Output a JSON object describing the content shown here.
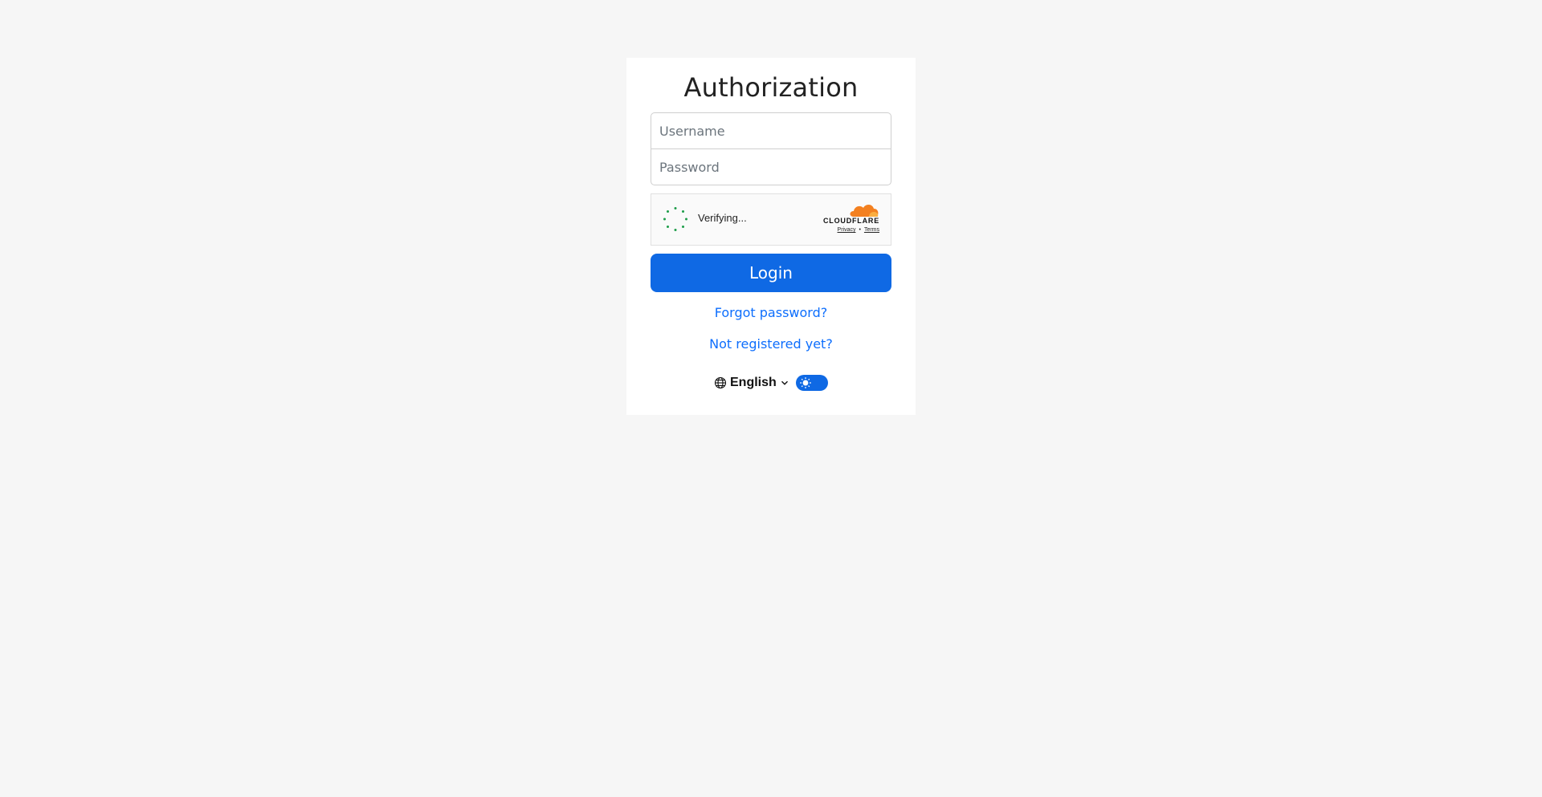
{
  "form": {
    "title": "Authorization",
    "username_placeholder": "Username",
    "password_placeholder": "Password",
    "login_label": "Login",
    "forgot_label": "Forgot password?",
    "register_label": "Not registered yet?"
  },
  "captcha": {
    "status": "Verifying...",
    "brand": "CLOUDFLARE",
    "privacy_label": "Privacy",
    "separator": "•",
    "terms_label": "Terms",
    "spinner_color": "#1e9e4a",
    "brand_color": "#f38020"
  },
  "footer": {
    "language": "English",
    "globe_icon": "globe-icon",
    "chevron_icon": "chevron-down-icon",
    "theme_toggle_icon": "sun-icon",
    "theme_toggle_on": true
  },
  "colors": {
    "background": "#f6f6f6",
    "card": "#ffffff",
    "primary": "#0f69e4",
    "link": "#0d6efd"
  }
}
